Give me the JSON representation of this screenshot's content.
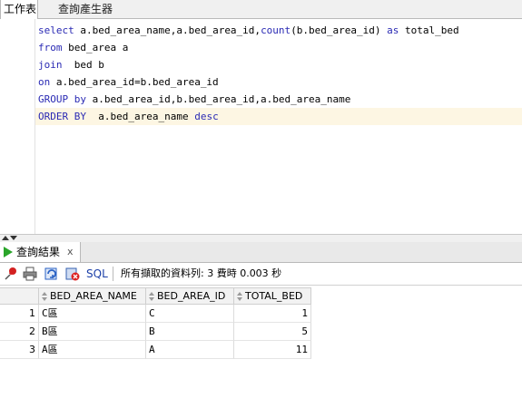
{
  "tabs": {
    "worksheet": "工作表",
    "query_builder": "查詢產生器"
  },
  "editor": {
    "lines": [
      {
        "parts": [
          {
            "t": "select",
            "k": true
          },
          {
            "t": " a.bed_area_name,a.bed_area_id,",
            "k": false
          },
          {
            "t": "count",
            "k": true
          },
          {
            "t": "(b.bed_area_id) ",
            "k": false
          },
          {
            "t": "as",
            "k": true
          },
          {
            "t": " total_bed",
            "k": false
          }
        ]
      },
      {
        "parts": [
          {
            "t": "from",
            "k": true
          },
          {
            "t": " bed_area a",
            "k": false
          }
        ]
      },
      {
        "parts": [
          {
            "t": "join",
            "k": true
          },
          {
            "t": "  bed b",
            "k": false
          }
        ]
      },
      {
        "parts": [
          {
            "t": "on",
            "k": true
          },
          {
            "t": " a.bed_area_id=b.bed_area_id",
            "k": false
          }
        ]
      },
      {
        "parts": [
          {
            "t": "GROUP by",
            "k": true
          },
          {
            "t": " a.bed_area_id,b.bed_area_id,a.bed_area_name",
            "k": false
          }
        ]
      },
      {
        "parts": [
          {
            "t": "ORDER BY",
            "k": true
          },
          {
            "t": "  a.bed_area_name ",
            "k": false
          },
          {
            "t": "desc",
            "k": true
          }
        ]
      }
    ]
  },
  "results": {
    "tab_label": "查詢結果",
    "close_label": "x",
    "sql_label": "SQL",
    "status": "所有擷取的資料列: 3 費時 0.003 秒",
    "columns": [
      "BED_AREA_NAME",
      "BED_AREA_ID",
      "TOTAL_BED"
    ],
    "rows": [
      {
        "n": "1",
        "name": "C區",
        "id": "C",
        "total": "1"
      },
      {
        "n": "2",
        "name": "B區",
        "id": "B",
        "total": "5"
      },
      {
        "n": "3",
        "name": "A區",
        "id": "A",
        "total": "11"
      }
    ]
  },
  "colors": {
    "keyword": "#2a2ab4",
    "current_line": "#fdf6e3",
    "run_icon": "#2aa52a"
  }
}
